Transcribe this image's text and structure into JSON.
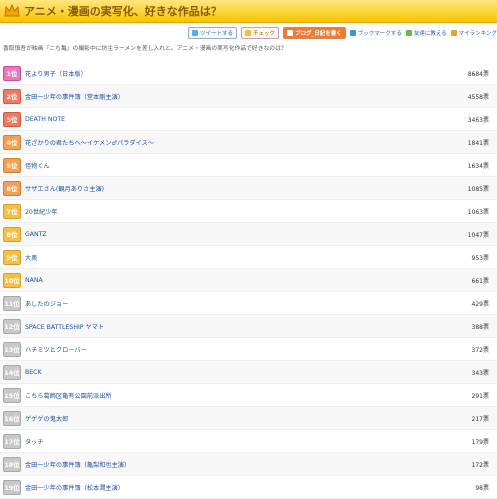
{
  "header": {
    "title": "アニメ・漫画の実写化、好きな作品は？"
  },
  "actions": [
    {
      "label": "ツイートする",
      "icon": "twitter-icon"
    },
    {
      "label": "チェック",
      "icon": "check-icon"
    },
    {
      "label": "ブログ_日記を書く",
      "icon": "blog-icon"
    },
    {
      "label": "ブックマークする",
      "icon": "bookmark-icon"
    },
    {
      "label": "友達に教える",
      "icon": "friend-icon"
    },
    {
      "label": "マイランキング",
      "icon": "ranking-icon"
    }
  ],
  "intro": "香取慎吾が映画『こち亀』の撮影中に坊主ラーメンを差し入れと。アニメ・漫画の実写化作品で好きなのは？",
  "rankings": [
    {
      "rank": "1位",
      "title": "花より男子（日本版）",
      "votes": "8684票"
    },
    {
      "rank": "2位",
      "title": "金田一少年の事件簿（堂本剛主演）",
      "votes": "4558票"
    },
    {
      "rank": "3位",
      "title": "DEATH NOTE",
      "votes": "3463票"
    },
    {
      "rank": "4位",
      "title": "花ざかりの君たちへ～イケメン♂パラダイス～",
      "votes": "1841票"
    },
    {
      "rank": "5位",
      "title": "怪物くん",
      "votes": "1634票"
    },
    {
      "rank": "6位",
      "title": "サザエさん(観月ありさ主演)",
      "votes": "1085票"
    },
    {
      "rank": "7位",
      "title": "20世紀少年",
      "votes": "1063票"
    },
    {
      "rank": "8位",
      "title": "GANTZ",
      "votes": "1047票"
    },
    {
      "rank": "9位",
      "title": "大奥",
      "votes": "953票"
    },
    {
      "rank": "10位",
      "title": "NANA",
      "votes": "661票"
    },
    {
      "rank": "11位",
      "title": "あしたのジョー",
      "votes": "429票"
    },
    {
      "rank": "12位",
      "title": "SPACE BATTLESHIP ヤマト",
      "votes": "388票"
    },
    {
      "rank": "13位",
      "title": "ハチミツとクローバー",
      "votes": "372票"
    },
    {
      "rank": "14位",
      "title": "BECK",
      "votes": "343票"
    },
    {
      "rank": "15位",
      "title": "こちら葛飾区亀有公園前派出所",
      "votes": "291票"
    },
    {
      "rank": "16位",
      "title": "ゲゲゲの鬼太郎",
      "votes": "217票"
    },
    {
      "rank": "17位",
      "title": "タッチ",
      "votes": "179票"
    },
    {
      "rank": "18位",
      "title": "金田一少年の事件簿（亀梨和也主演）",
      "votes": "172票"
    },
    {
      "rank": "19位",
      "title": "金田一少年の事件簿（松本潤主演）",
      "votes": "98票"
    }
  ],
  "rank_colors": {
    "pink": "#e878b8",
    "red": "#ef7a62",
    "orange": "#f2a054",
    "yellow": "#f5bf46",
    "gray": "#c8c8c8"
  }
}
